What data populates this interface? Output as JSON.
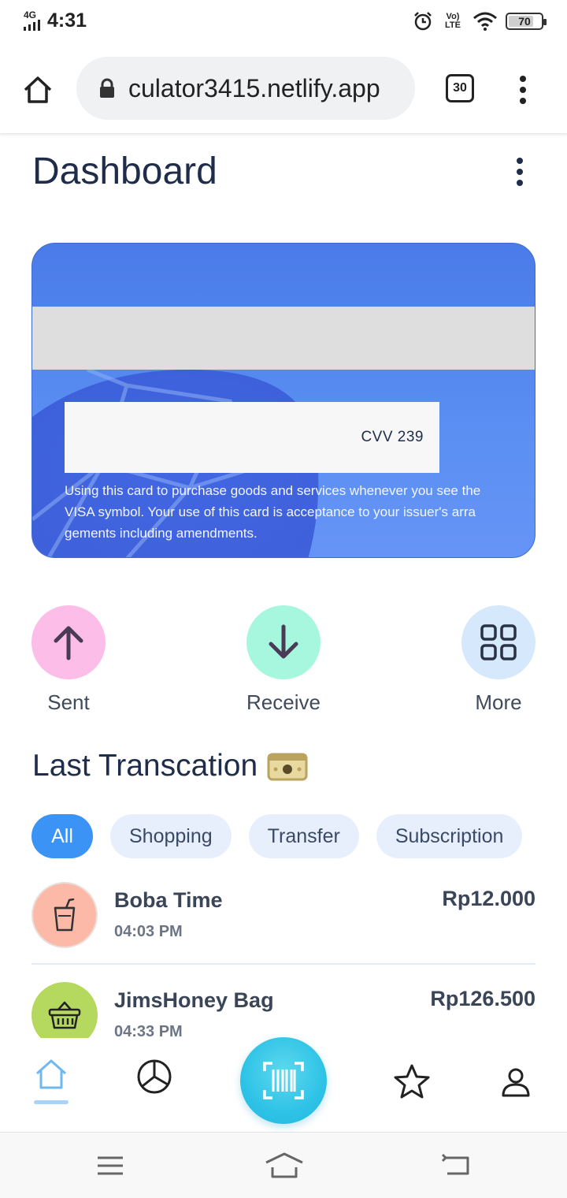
{
  "status_bar": {
    "network": "4G",
    "time": "4:31",
    "lte_label": "Vo) LTE",
    "battery": "70",
    "battery_level": 0.7
  },
  "browser": {
    "url": "culator3415.netlify.app",
    "tab_count": "30"
  },
  "page": {
    "title": "Dashboard"
  },
  "card": {
    "cvv_label": "CVV  239",
    "note": "Using this card to purchase goods and services whenever you see the VISA symbol. Your use of this card is acceptance to your issuer's arra gements including amendments."
  },
  "actions": [
    {
      "label": "Sent",
      "icon": "arrow-up-icon",
      "color": "#fcbde9"
    },
    {
      "label": "Receive",
      "icon": "arrow-down-icon",
      "color": "#a7f7df"
    },
    {
      "label": "More",
      "icon": "grid-icon",
      "color": "#d6e8fc"
    }
  ],
  "transactions_section": {
    "title": "Last Transcation",
    "filters": [
      "All",
      "Shopping",
      "Transfer",
      "Subscription"
    ],
    "active_filter": "All",
    "items": [
      {
        "name": "Boba Time",
        "time": "04:03 PM",
        "amount": "Rp12.000",
        "icon": "cup-icon",
        "color": "#fdb9a8"
      },
      {
        "name": "JimsHoney Bag",
        "time": "04:33 PM",
        "amount": "Rp126.500",
        "icon": "basket-icon",
        "color": "#b5d95e"
      }
    ]
  },
  "bottom_nav": {
    "items": [
      "home-icon",
      "chart-icon",
      "scan-icon",
      "star-icon",
      "profile-icon"
    ],
    "active": "home-icon",
    "accent": "#2ec3e6"
  }
}
